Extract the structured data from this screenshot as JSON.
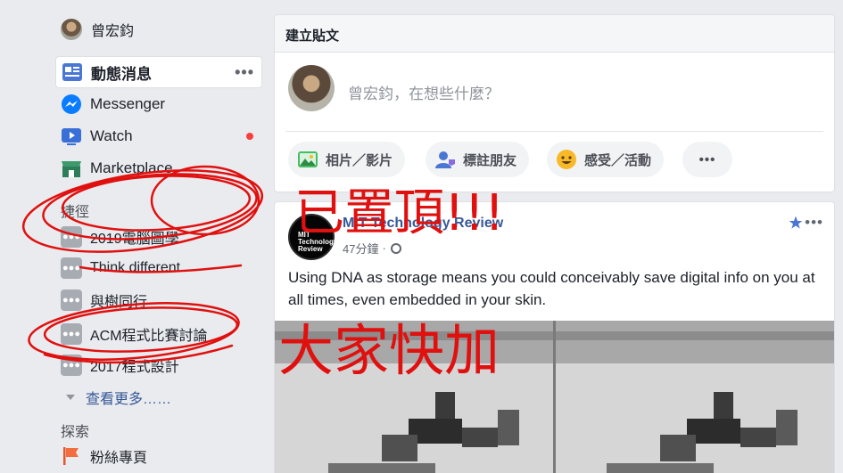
{
  "profile": {
    "name": "曾宏鈞"
  },
  "nav": {
    "items": [
      {
        "label": "動態消息",
        "icon": "news-feed-icon"
      },
      {
        "label": "Messenger",
        "icon": "messenger-icon"
      },
      {
        "label": "Watch",
        "icon": "watch-icon"
      },
      {
        "label": "Marketplace",
        "icon": "marketplace-icon"
      }
    ],
    "more_dots": "•••"
  },
  "shortcuts": {
    "title": "捷徑",
    "groups": [
      "2019電腦圖學",
      "Think different",
      "與樹同行",
      "ACM程式比賽討論",
      "2017程式設計"
    ],
    "see_more": "查看更多……"
  },
  "explore": {
    "title": "探索",
    "items": [
      "粉絲專頁"
    ]
  },
  "composer": {
    "title": "建立貼文",
    "placeholder": "曾宏鈞，在想些什麼？",
    "buttons": [
      "相片／影片",
      "標註朋友",
      "感受／活動"
    ],
    "more": "•••"
  },
  "post": {
    "author": "MIT Technology Review",
    "avatar_text": "MIT Technology Review",
    "time": "47分鐘",
    "separator": "·",
    "text": "Using DNA as storage means you could conceivably save digital info on you at all times, even embedded in your skin.",
    "actions": "•••"
  },
  "annotations": {
    "top": "已置頂!!!",
    "bottom": "大家快加"
  },
  "colors": {
    "accent": "#385898",
    "annotation": "#e0100f",
    "background": "#e9ebee"
  }
}
